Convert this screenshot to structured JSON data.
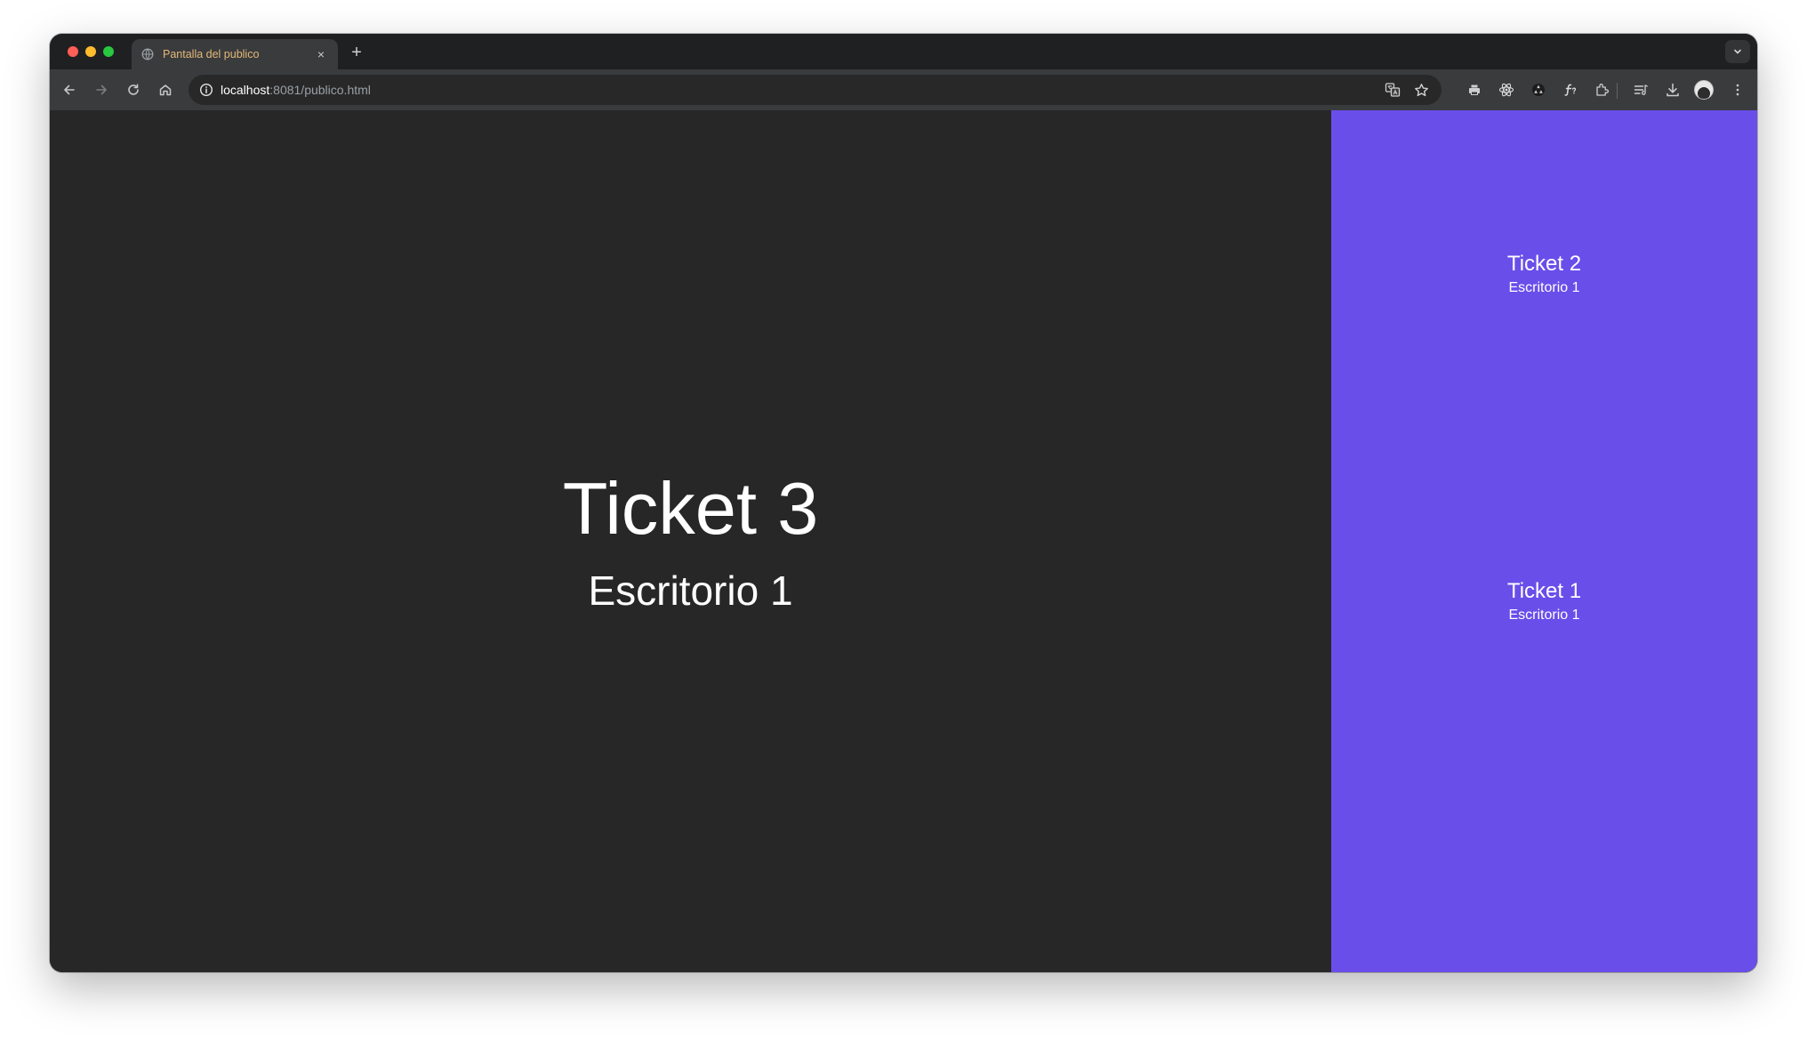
{
  "browser": {
    "tab": {
      "title": "Pantalla del publico",
      "close_glyph": "×"
    },
    "new_tab_glyph": "+",
    "address": {
      "host": "localhost",
      "rest": ":8081/publico.html"
    }
  },
  "page": {
    "current": {
      "ticket": "Ticket 3",
      "desk": "Escritorio 1"
    },
    "history": [
      {
        "ticket": "Ticket 2",
        "desk": "Escritorio 1"
      },
      {
        "ticket": "Ticket 1",
        "desk": "Escritorio 1"
      }
    ]
  },
  "colors": {
    "main_background": "#272727",
    "sidebar_background": "#6a4eea",
    "text": "#ffffff"
  }
}
